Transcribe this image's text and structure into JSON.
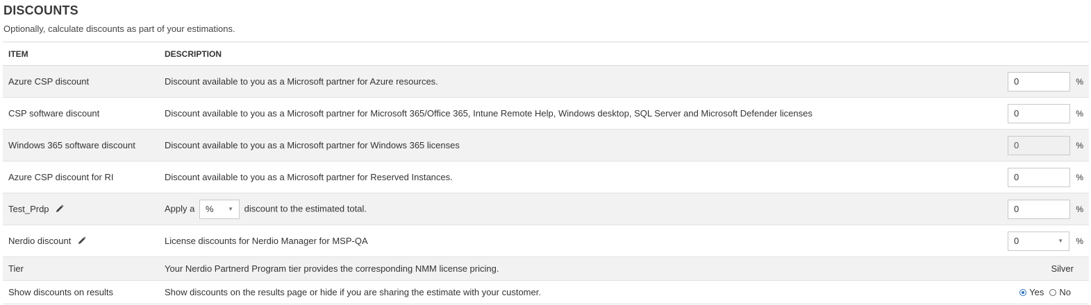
{
  "header": {
    "title": "DISCOUNTS",
    "subtitle": "Optionally, calculate discounts as part of your estimations."
  },
  "table": {
    "columns": [
      "ITEM",
      "DESCRIPTION"
    ],
    "rows": [
      {
        "item": "Azure CSP discount",
        "description": "Discount available to you as a Microsoft partner for Azure resources.",
        "value": "0",
        "unit": "%"
      },
      {
        "item": "CSP software discount",
        "description": "Discount available to you as a Microsoft partner for Microsoft 365/Office 365, Intune Remote Help, Windows desktop, SQL Server and Microsoft Defender licenses",
        "value": "0",
        "unit": "%"
      },
      {
        "item": "Windows 365 software discount",
        "description": "Discount available to you as a Microsoft partner for Windows 365 licenses",
        "value": "0",
        "unit": "%"
      },
      {
        "item": "Azure CSP discount for RI",
        "description": "Discount available to you as a Microsoft partner for Reserved Instances.",
        "value": "0",
        "unit": "%"
      },
      {
        "item": "Test_Prdp",
        "description_prefix": "Apply a",
        "type_select": "%",
        "description_suffix": "discount to the estimated total.",
        "value": "0",
        "unit": "%"
      },
      {
        "item": "Nerdio discount",
        "description": "License discounts for Nerdio Manager for MSP-QA",
        "value": "0",
        "unit": "%"
      },
      {
        "item": "Tier",
        "description": "Your Nerdio Partnerd Program tier provides the corresponding NMM license pricing.",
        "value": "Silver"
      },
      {
        "item": "Show discounts on results",
        "description": "Show discounts on the results page or hide if you are sharing the estimate with your customer.",
        "yes_label": "Yes",
        "no_label": "No"
      }
    ]
  },
  "colors": {
    "accent": "#2c6fbb",
    "row_shade": "#f2f2f2"
  },
  "icons": {
    "edit": "pencil-icon"
  }
}
